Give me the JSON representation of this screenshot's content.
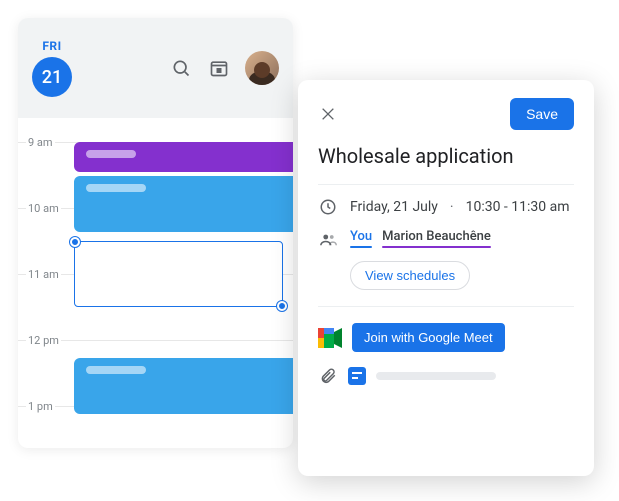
{
  "calendar": {
    "day_label": "FRI",
    "day_number": "21",
    "hours": [
      "9 am",
      "10 am",
      "11 am",
      "12 pm",
      "1 pm"
    ]
  },
  "detail": {
    "save_label": "Save",
    "title": "Wholesale application",
    "date_text": "Friday, 21 July",
    "time_text": "10:30 - 11:30 am",
    "dot": "·",
    "attendees": {
      "you": "You",
      "other": "Marion Beauchêne"
    },
    "view_schedules_label": "View schedules",
    "meet_label": "Join with Google Meet"
  }
}
